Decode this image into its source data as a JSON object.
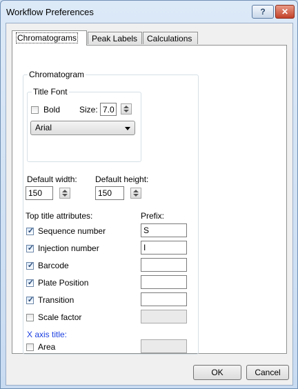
{
  "window": {
    "title": "Workflow Preferences",
    "help_glyph": "?",
    "close_glyph": "✕"
  },
  "tabs": [
    {
      "label": "Chromatograms",
      "selected": true
    },
    {
      "label": "Peak Labels",
      "selected": false
    },
    {
      "label": "Calculations",
      "selected": false
    }
  ],
  "chromatogram_group": {
    "label": "Chromatogram",
    "title_font": {
      "label": "Title Font",
      "bold_label": "Bold",
      "bold_checked": false,
      "size_label": "Size:",
      "size_value": "7.0",
      "font_value": "Arial"
    },
    "default_width_label": "Default width:",
    "default_width_value": "150",
    "default_height_label": "Default height:",
    "default_height_value": "150",
    "top_title_label": "Top title attributes:",
    "prefix_label": "Prefix:",
    "attributes": [
      {
        "label": "Sequence number",
        "checked": true,
        "prefix": "S",
        "enabled": true
      },
      {
        "label": "Injection number",
        "checked": true,
        "prefix": "I",
        "enabled": true
      },
      {
        "label": "Barcode",
        "checked": true,
        "prefix": "",
        "enabled": true
      },
      {
        "label": "Plate Position",
        "checked": true,
        "prefix": "",
        "enabled": true
      },
      {
        "label": "Transition",
        "checked": true,
        "prefix": "",
        "enabled": true
      },
      {
        "label": "Scale factor",
        "checked": false,
        "prefix": "",
        "enabled": false
      }
    ],
    "x_axis_title_label": "X axis title:",
    "area_label": "Area",
    "area_checked": false,
    "area_prefix": ""
  },
  "buttons": {
    "ok": "OK",
    "cancel": "Cancel"
  },
  "icons": {
    "check": "checkmark-icon",
    "help": "help-icon",
    "close": "close-icon"
  }
}
